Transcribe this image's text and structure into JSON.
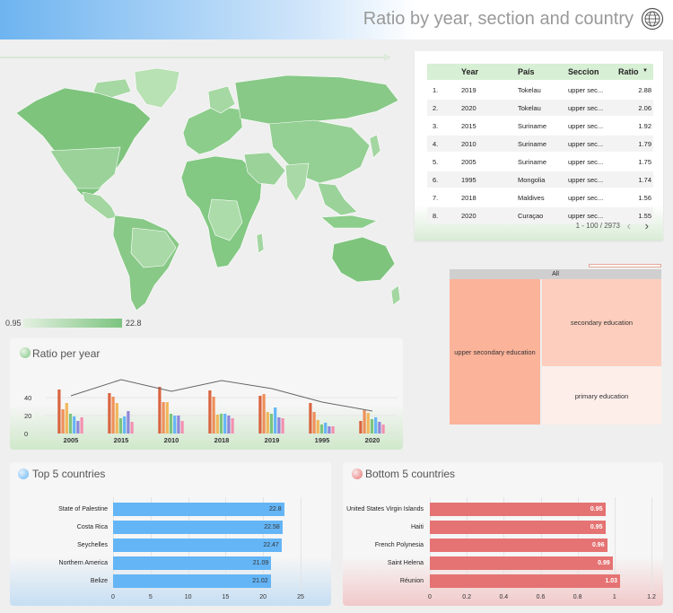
{
  "header": {
    "title": "Ratio by year, section and country",
    "icon": "globe-icon"
  },
  "map": {
    "legend_min": "0.95",
    "legend_max": "22.8",
    "colors": {
      "low": "#e3f0e0",
      "high": "#7cc47f"
    }
  },
  "table": {
    "columns": [
      "Year",
      "País",
      "Seccion",
      "Ratio"
    ],
    "sort_indicator": "▼",
    "rows": [
      {
        "n": "1.",
        "year": "2019",
        "country": "Tokelau",
        "section": "upper sec...",
        "ratio": "2.88"
      },
      {
        "n": "2.",
        "year": "2020",
        "country": "Tokelau",
        "section": "upper sec...",
        "ratio": "2.06"
      },
      {
        "n": "3.",
        "year": "2015",
        "country": "Suriname",
        "section": "upper sec...",
        "ratio": "1.92"
      },
      {
        "n": "4.",
        "year": "2010",
        "country": "Suriname",
        "section": "upper sec...",
        "ratio": "1.79"
      },
      {
        "n": "5.",
        "year": "2005",
        "country": "Suriname",
        "section": "upper sec...",
        "ratio": "1.75"
      },
      {
        "n": "6.",
        "year": "1995",
        "country": "Mongolia",
        "section": "upper sec...",
        "ratio": "1.74"
      },
      {
        "n": "7.",
        "year": "2018",
        "country": "Maldives",
        "section": "upper sec...",
        "ratio": "1.56"
      },
      {
        "n": "8.",
        "year": "2020",
        "country": "Curaçao",
        "section": "upper sec...",
        "ratio": "1.55"
      }
    ],
    "pagination": "1 - 100 / 2973",
    "prev_icon": "chevron-left-icon",
    "next_icon": "chevron-right-icon"
  },
  "treemap": {
    "root_label": "All",
    "nodes": [
      {
        "label": "upper secondary education",
        "color": "#fbb39a"
      },
      {
        "label": "secondary education",
        "color": "#fdcebd"
      },
      {
        "label": "primary education",
        "color": "#feeeea"
      }
    ]
  },
  "ratio_per_year": {
    "title": "Ratio per year"
  },
  "top5": {
    "title": "Top 5 countries",
    "color": "#64b5f6"
  },
  "bottom5": {
    "title": "Bottom 5 countries",
    "color": "#e57373"
  },
  "chart_data": [
    {
      "type": "bar",
      "title": "Ratio per year",
      "categories": [
        "2005",
        "2015",
        "2010",
        "2018",
        "2019",
        "1995",
        "2020"
      ],
      "ylim": [
        0,
        60
      ],
      "yticks": [
        0,
        20,
        40,
        60
      ],
      "grid": true,
      "bar_colors": [
        "#d9643f",
        "#ef8f5a",
        "#f2b65b",
        "#7cc47f",
        "#64b5f6",
        "#8f86d9",
        "#f48fb1"
      ],
      "series_values": [
        [
          49,
          27,
          34,
          22,
          19,
          14,
          18
        ],
        [
          45,
          41,
          34,
          17,
          19,
          25,
          13
        ],
        [
          52,
          35,
          35,
          22,
          20,
          20,
          14
        ],
        [
          48,
          41,
          21,
          22,
          22,
          20,
          17
        ],
        [
          42,
          44,
          24,
          22,
          29,
          18,
          17
        ],
        [
          34,
          24,
          15,
          10,
          12,
          8,
          8
        ],
        [
          14,
          26,
          23,
          16,
          18,
          13,
          10
        ]
      ],
      "line_values": [
        42,
        60,
        47,
        59,
        50,
        35,
        25
      ]
    },
    {
      "type": "bar",
      "orientation": "horizontal",
      "title": "Top 5 countries",
      "categories": [
        "State of Palestine",
        "Costa Rica",
        "Seychelles",
        "Northern America",
        "Belize"
      ],
      "values": [
        22.8,
        22.58,
        22.47,
        21.09,
        21.02
      ],
      "value_labels": [
        "22.8",
        "22.58",
        "22.47",
        "21.09",
        "21.02"
      ],
      "xlim": [
        0,
        25
      ],
      "xticks": [
        "0",
        "5",
        "10",
        "15",
        "20",
        "25"
      ]
    },
    {
      "type": "bar",
      "orientation": "horizontal",
      "title": "Bottom 5 countries",
      "categories": [
        "United States Virgin Islands",
        "Haiti",
        "French Polynesia",
        "Saint Helena",
        "Réunion"
      ],
      "values": [
        0.95,
        0.95,
        0.96,
        0.99,
        1.03
      ],
      "value_labels": [
        "0.95",
        "0.95",
        "0.96",
        "0.99",
        "1.03"
      ],
      "xlim": [
        0,
        1.2
      ],
      "xticks": [
        "0",
        "0.2",
        "0.4",
        "0.6",
        "0.8",
        "1",
        "1.2"
      ]
    }
  ]
}
